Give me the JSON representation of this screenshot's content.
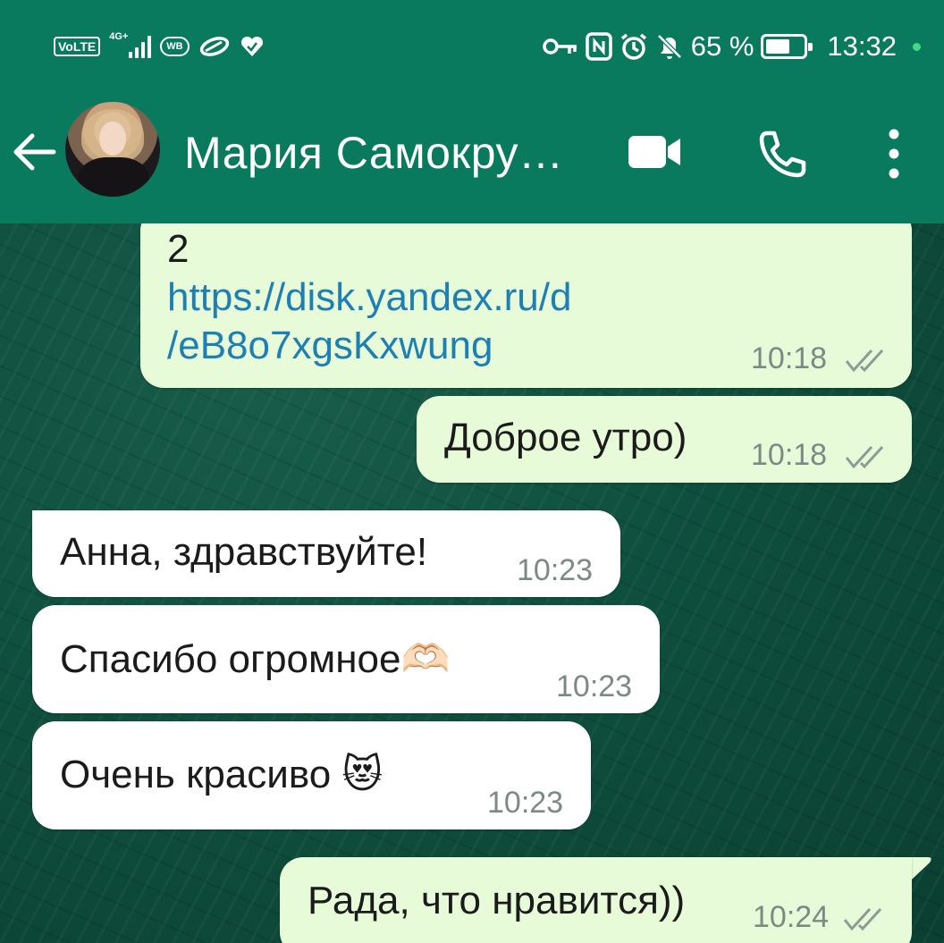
{
  "status_bar": {
    "volte": "VoLTE",
    "network": "4G+",
    "wb": "WB",
    "battery_percent": "65 %",
    "battery_level": 0.65,
    "time": "13:32",
    "icons": [
      "key-icon",
      "nfc-icon",
      "alarm-icon",
      "bell-off-icon"
    ]
  },
  "chat_header": {
    "contact_name": "Мария Самокру…",
    "back_icon": "arrow-left-icon",
    "video_icon": "video-camera-icon",
    "call_icon": "phone-icon",
    "menu_icon": "more-vertical-icon"
  },
  "messages": [
    {
      "direction": "outgoing",
      "lines": [
        "2",
        "https://disk.yandex.ru/d",
        "/eB8o7xgsKxwung"
      ],
      "time": "10:18",
      "status": "read"
    },
    {
      "direction": "outgoing",
      "text": "Доброе утро)",
      "time": "10:18",
      "status": "read"
    },
    {
      "direction": "incoming",
      "text": "Анна, здравствуйте!",
      "time": "10:23"
    },
    {
      "direction": "incoming",
      "text": "Спасибо огромное🫶🏻",
      "time": "10:23"
    },
    {
      "direction": "incoming",
      "text": "Очень красиво 😻",
      "time": "10:23"
    },
    {
      "direction": "outgoing",
      "text": "Рада, что нравится))",
      "time": "10:24",
      "status": "read"
    }
  ],
  "colors": {
    "header": "#0a7a5e",
    "outgoing_bubble": "#e7fbd9",
    "incoming_bubble": "#ffffff",
    "link": "#1e7fb3",
    "time": "#7d8a84",
    "wallpaper": "#0f4f3e"
  }
}
